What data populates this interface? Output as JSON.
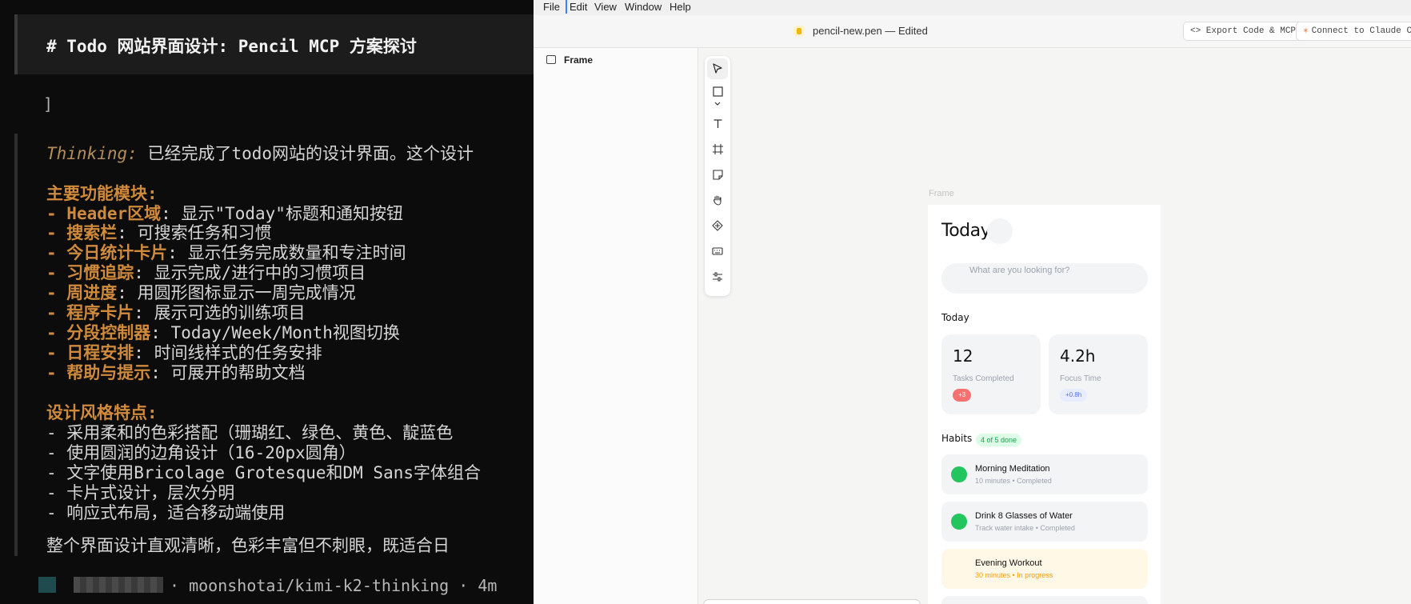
{
  "terminal": {
    "header_title": "# Todo 网站界面设计: Pencil MCP 方案探讨",
    "bracket": "]",
    "thinking_label": "Thinking:",
    "thinking_text": " 已经完成了todo网站的设计界面。这个设计",
    "section1_title": "主要功能模块:",
    "features": [
      {
        "dash": "- ",
        "key": "Header区域",
        "desc": ": 显示\"Today\"标题和通知按钮"
      },
      {
        "dash": "- ",
        "key": "搜索栏",
        "desc": ": 可搜索任务和习惯"
      },
      {
        "dash": "- ",
        "key": "今日统计卡片",
        "desc": ": 显示任务完成数量和专注时间"
      },
      {
        "dash": "- ",
        "key": "习惯追踪",
        "desc": ": 显示完成/进行中的习惯项目"
      },
      {
        "dash": "- ",
        "key": "周进度",
        "desc": ": 用圆形图标显示一周完成情况"
      },
      {
        "dash": "- ",
        "key": "程序卡片",
        "desc": ": 展示可选的训练项目"
      },
      {
        "dash": "- ",
        "key": "分段控制器",
        "desc": ": Today/Week/Month视图切换"
      },
      {
        "dash": "- ",
        "key": "日程安排",
        "desc": ": 时间线样式的任务安排"
      },
      {
        "dash": "- ",
        "key": "帮助与提示",
        "desc": ": 可展开的帮助文档"
      }
    ],
    "section2_title": "设计风格特点:",
    "styles": [
      "- 采用柔和的色彩搭配（珊瑚红、绿色、黄色、靛蓝色",
      "- 使用圆润的边角设计（16-20px圆角）",
      "- 文字使用Bricolage Grotesque和DM Sans字体组合",
      "- 卡片式设计，层次分明",
      "- 响应式布局，适合移动端使用"
    ],
    "summary": "整个界面设计直观清晰，色彩丰富但不刺眼，既适合日",
    "footer_text": "· moonshotai/kimi-k2-thinking · 4m"
  },
  "app": {
    "menu": [
      "File",
      "Edit",
      "View",
      "Window",
      "Help"
    ],
    "doc_title": "pencil-new.pen — Edited",
    "export_button": "<> Export Code & MCP",
    "claude_button": "Connect to Claude Code",
    "layers": [
      {
        "label": "Frame"
      }
    ],
    "tools": [
      "cursor-icon",
      "rectangle-icon",
      "chevron-down-icon",
      "text-icon",
      "frame-icon",
      "sticky-note-icon",
      "hand-icon",
      "component-icon",
      "keyboard-icon",
      "sliders-icon"
    ],
    "canvas_label": "Frame",
    "frame": {
      "title": "Today",
      "search_placeholder": "What are you looking for?",
      "today_section": "Today",
      "stats": [
        {
          "value": "12",
          "label": "Tasks Completed",
          "pill": "+3"
        },
        {
          "value": "4.2h",
          "label": "Focus Time",
          "pill": "+0.8h"
        }
      ],
      "habits_section": "Habits",
      "habits_badge": "4 of 5 done",
      "habits": [
        {
          "name": "Morning Meditation",
          "sub": "10 minutes • Completed"
        },
        {
          "name": "Drink 8 Glasses of Water",
          "sub": "Track water intake • Completed"
        },
        {
          "name": "Evening Workout",
          "sub": "30 minutes • In progress"
        }
      ]
    }
  }
}
